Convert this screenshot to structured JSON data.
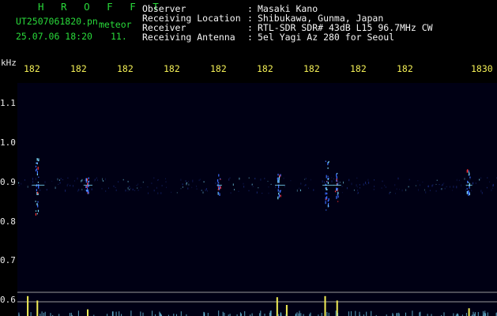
{
  "header": {
    "title": "H R O F F T",
    "filename": "UT2507061820.pn",
    "meteor_label": "meteor",
    "datetime": "25.07.06 18:20",
    "count": "11."
  },
  "station": {
    "labels": [
      "Observer",
      "Receiving Location",
      "Receiver",
      "Receiving Antenna"
    ],
    "separators": [
      ":",
      ":",
      ":",
      ":"
    ],
    "values": [
      "Masaki Kano",
      "Shibukawa, Gunma, Japan",
      "RTL-SDR SDR# 43dB L15 96.7MHz CW",
      "5el Yagi Az 280 for Seoul"
    ]
  },
  "axes": {
    "y_unit": "kHz",
    "y_ticks": [
      "1.1",
      "1.0",
      "0.9",
      "0.8",
      "0.7",
      "0.6"
    ],
    "x_ticks": [
      "182",
      "182",
      "182",
      "182",
      "182",
      "182",
      "182",
      "182",
      "182",
      "1830"
    ]
  },
  "colors": {
    "background": "#000000",
    "plot_bg": "#000014",
    "header_green": "#29d93a",
    "tick_yellow": "#f2ee55",
    "echo_blue": "#3b6cff",
    "echo_cyan": "#7fe0ff",
    "echo_red": "#ff3030",
    "bar_yellow": "#f2ee55"
  },
  "chart_data": {
    "type": "heatmap",
    "y_range_khz": [
      0.58,
      1.15
    ],
    "echo_band_khz": 0.9,
    "echoes": [
      {
        "t": 0.04,
        "f_lo": 0.82,
        "f_hi": 0.97,
        "strength": 1.0
      },
      {
        "t": 0.145,
        "f_lo": 0.88,
        "f_hi": 0.92,
        "strength": 0.7
      },
      {
        "t": 0.42,
        "f_lo": 0.88,
        "f_hi": 0.93,
        "strength": 0.4
      },
      {
        "t": 0.545,
        "f_lo": 0.87,
        "f_hi": 0.93,
        "strength": 0.8
      },
      {
        "t": 0.645,
        "f_lo": 0.83,
        "f_hi": 0.96,
        "strength": 0.9
      },
      {
        "t": 0.665,
        "f_lo": 0.86,
        "f_hi": 0.93,
        "strength": 0.6
      },
      {
        "t": 0.94,
        "f_lo": 0.88,
        "f_hi": 0.94,
        "strength": 0.5
      }
    ],
    "activity_bars": [
      {
        "t": 0.02,
        "level": 0.9
      },
      {
        "t": 0.04,
        "level": 0.7
      },
      {
        "t": 0.145,
        "level": 0.3
      },
      {
        "t": 0.54,
        "level": 0.85
      },
      {
        "t": 0.56,
        "level": 0.5
      },
      {
        "t": 0.64,
        "level": 0.9
      },
      {
        "t": 0.665,
        "level": 0.7
      },
      {
        "t": 0.94,
        "level": 0.35
      }
    ]
  }
}
